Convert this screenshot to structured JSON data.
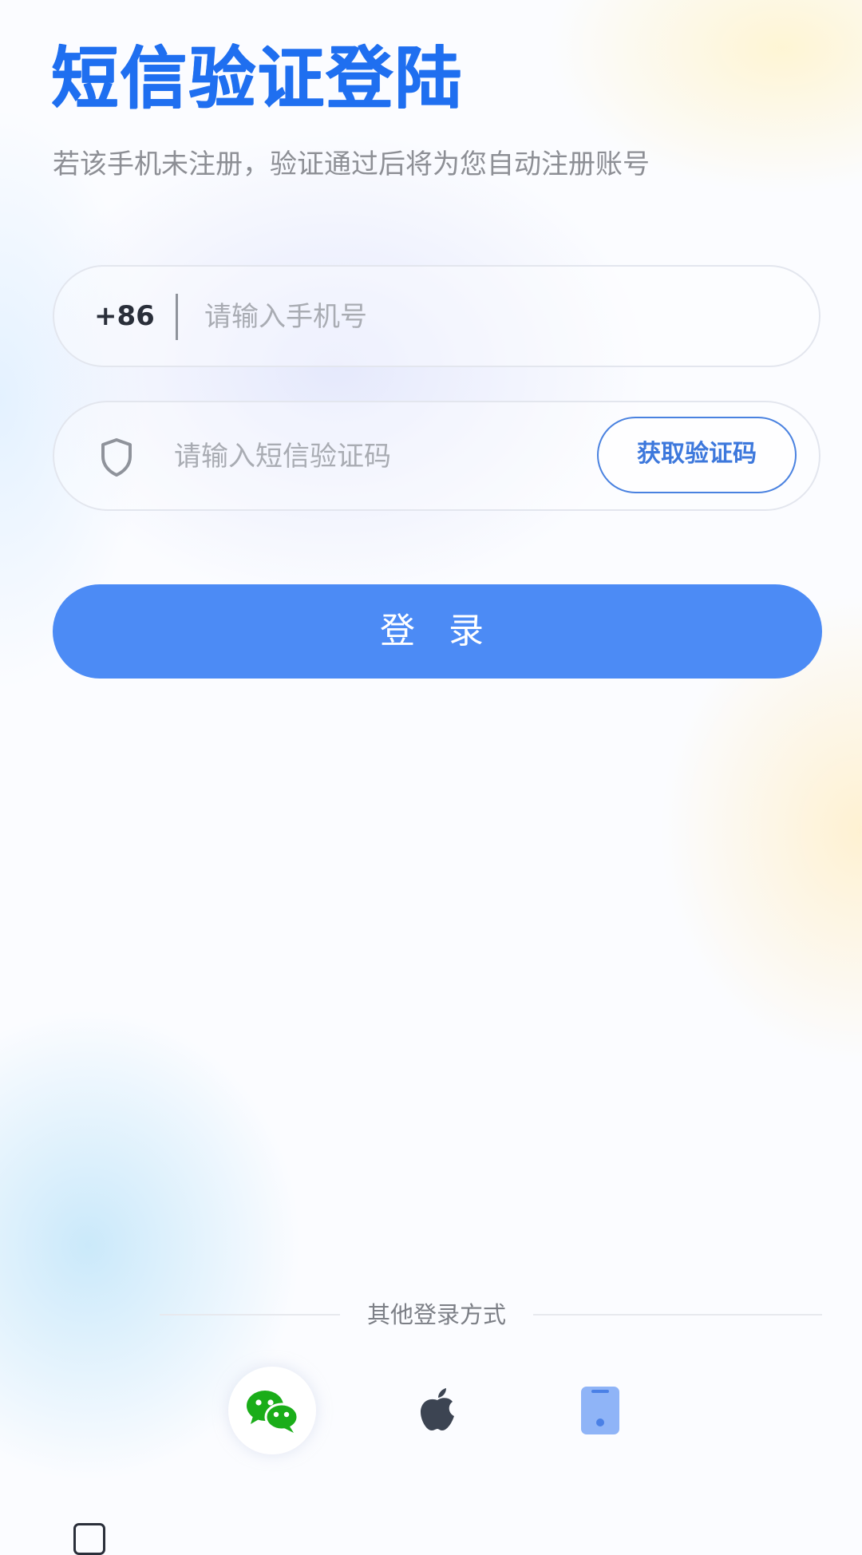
{
  "header": {
    "title": "短信验证登陆",
    "subtitle": "若该手机未注册，验证通过后将为您自动注册账号"
  },
  "phone": {
    "country_code": "+86",
    "placeholder": "请输入手机号",
    "value": ""
  },
  "code": {
    "placeholder": "请输入短信验证码",
    "value": "",
    "get_code_label": "获取验证码"
  },
  "login": {
    "label": "登 录"
  },
  "other_login": {
    "label": "其他登录方式",
    "options": [
      {
        "name": "wechat",
        "icon": "wechat-icon"
      },
      {
        "name": "apple",
        "icon": "apple-icon"
      },
      {
        "name": "phone",
        "icon": "phone-icon"
      }
    ]
  },
  "colors": {
    "title": "#1f6ff0",
    "primary": "#4c8bf5",
    "wechat": "#1aad19",
    "apple": "#3c4452",
    "phone_icon": "#8fb4f7"
  }
}
